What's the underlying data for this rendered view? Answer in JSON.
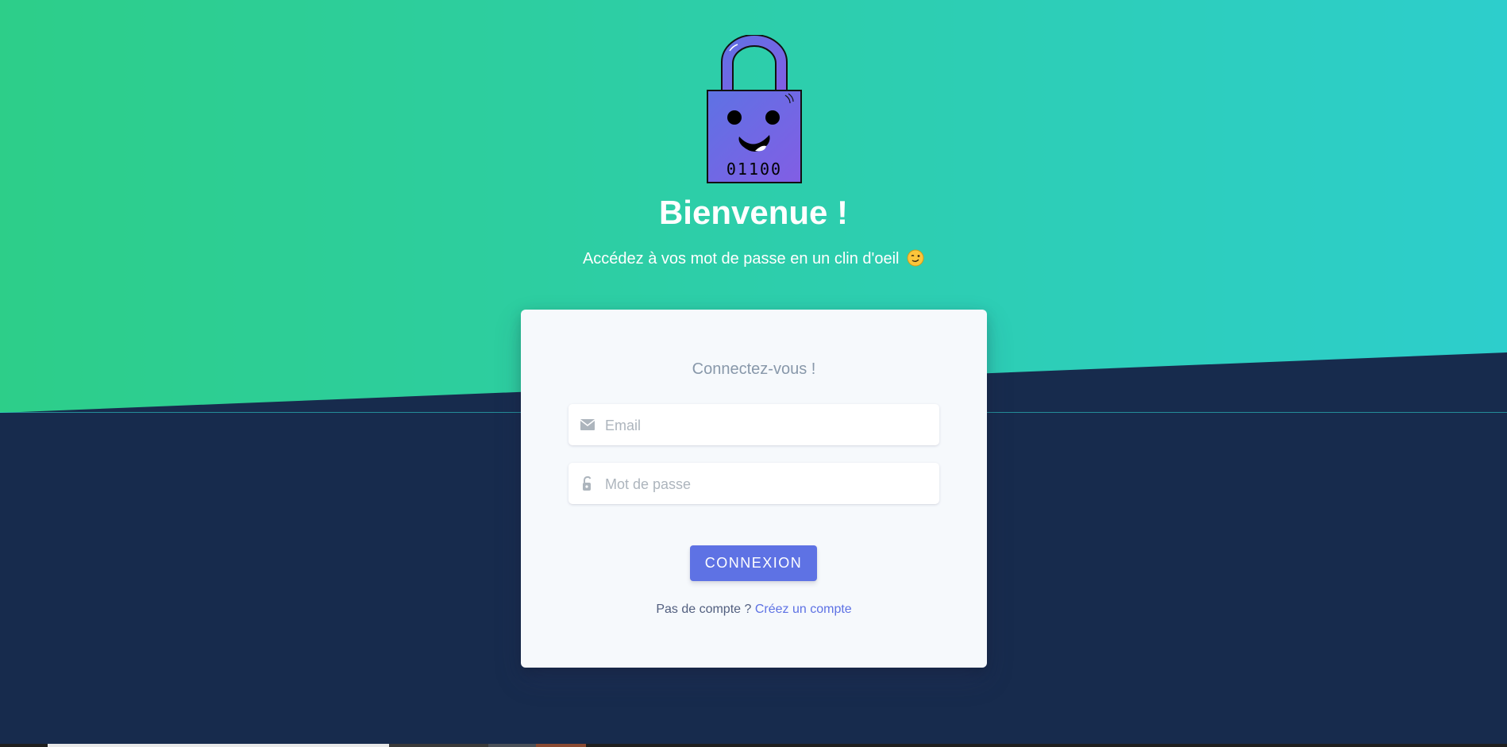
{
  "hero": {
    "logo_digits": "01100",
    "title": "Bienvenue !",
    "subtitle": "Accédez à vos mot de passe en un clin d'oeil"
  },
  "login": {
    "heading": "Connectez-vous !",
    "email_placeholder": "Email",
    "password_placeholder": "Mot de passe",
    "submit_label": "CONNEXION",
    "no_account_text": "Pas de compte ?",
    "signup_link": "Créez un compte"
  },
  "icons": {
    "logo": "padlock-mascot-icon",
    "emoji": "winking-face-icon",
    "email": "envelope-icon",
    "password": "unlock-icon"
  },
  "colors": {
    "gradient_start": "#2dce89",
    "gradient_end": "#2dcecc",
    "background": "#172b4d",
    "card": "#f6f9fc",
    "primary": "#5e72e4",
    "muted": "#8898aa"
  }
}
